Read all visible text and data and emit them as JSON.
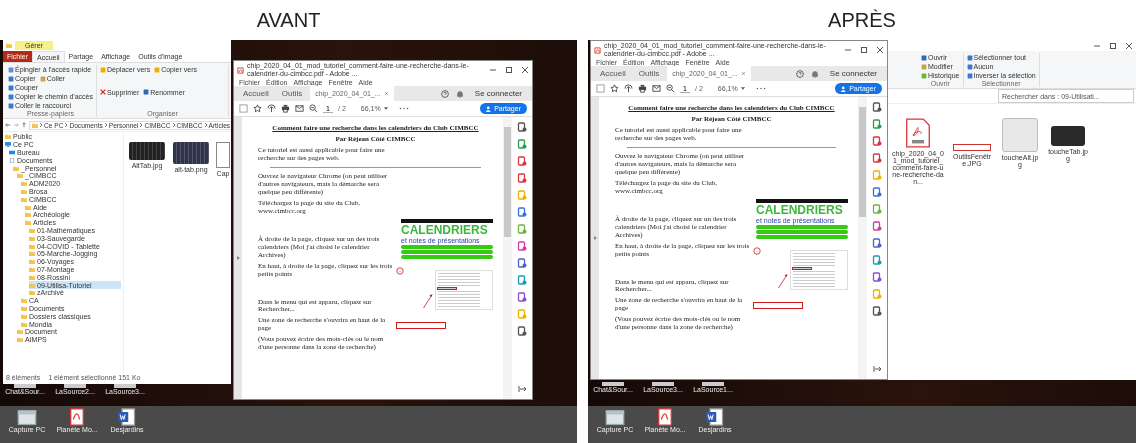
{
  "panels": [
    {
      "caption": "AVANT",
      "explorer": {
        "context_tab": "Gérer",
        "ribbon_tabs": [
          {
            "label": "Fichier",
            "kind": "file",
            "selected": false
          },
          {
            "label": "Accueil",
            "kind": "tab",
            "selected": true
          },
          {
            "label": "Partage",
            "kind": "tab",
            "selected": false
          },
          {
            "label": "Affichage",
            "kind": "tab",
            "selected": false
          },
          {
            "label": "Outils d'image",
            "kind": "tab",
            "selected": false
          }
        ],
        "ribbon_groups": [
          {
            "label": "Presse-papiers",
            "commands": [
              {
                "label": "Épingler à l'accès rapide",
                "kind": "pin"
              },
              {
                "label": "Copier",
                "kind": "copy"
              },
              {
                "label": "Coller",
                "kind": "paste"
              },
              {
                "label": "Couper",
                "kind": "cut"
              },
              {
                "label": "Copier le chemin d'accès",
                "kind": "path"
              },
              {
                "label": "Coller le raccourci",
                "kind": "shortcut"
              }
            ]
          },
          {
            "label": "Organiser",
            "commands": [
              {
                "label": "Déplacer vers",
                "kind": "move"
              },
              {
                "label": "Copier vers",
                "kind": "move"
              },
              {
                "label": "Supprimer",
                "kind": "delete"
              },
              {
                "label": "Renommer",
                "kind": "rename"
              }
            ]
          }
        ],
        "address": [
          "Ce PC",
          "Documents",
          "Personnel",
          "CIMBCC",
          "CIMBCC",
          "Articles"
        ],
        "tree": [
          {
            "label": "Public",
            "selected": false
          },
          {
            "label": "Ce PC",
            "kind": "pc",
            "selected": false,
            "children": [
              {
                "label": "Bureau",
                "kind": "desktop",
                "selected": false
              },
              {
                "label": "Documents",
                "kind": "docs",
                "selected": false,
                "children": [
                  {
                    "label": "_Personnel",
                    "selected": false,
                    "children": [
                      {
                        "label": "_CIMBCC",
                        "selected": false,
                        "children": [
                          {
                            "label": "ADM2020",
                            "selected": false
                          },
                          {
                            "label": "Brosa",
                            "selected": false
                          },
                          {
                            "label": "CIMBCC",
                            "selected": false,
                            "children": [
                              {
                                "label": "Aide",
                                "selected": false
                              },
                              {
                                "label": "Archéologie",
                                "selected": false
                              },
                              {
                                "label": "Articles",
                                "selected": false,
                                "children": [
                                  {
                                    "label": "01-Mathématiques",
                                    "selected": false
                                  },
                                  {
                                    "label": "03-Sauvegarde",
                                    "selected": false
                                  },
                                  {
                                    "label": "04-COVID - Tablette",
                                    "selected": false
                                  },
                                  {
                                    "label": "05-Marche-Jogging",
                                    "selected": false
                                  },
                                  {
                                    "label": "06-Voyages",
                                    "selected": false
                                  },
                                  {
                                    "label": "07-Montage",
                                    "selected": false
                                  },
                                  {
                                    "label": "08-Rossini",
                                    "selected": false
                                  },
                                  {
                                    "label": "09-Utilisa-Tutoriel",
                                    "selected": true
                                  },
                                  {
                                    "label": "zArchivé",
                                    "selected": false
                                  }
                                ]
                              }
                            ]
                          },
                          {
                            "label": "CA",
                            "selected": false
                          },
                          {
                            "label": "Documents",
                            "selected": false
                          },
                          {
                            "label": "Dossiers classiques",
                            "selected": false
                          },
                          {
                            "label": "Mondia",
                            "selected": false
                          }
                        ]
                      },
                      {
                        "label": "Document",
                        "selected": false
                      },
                      {
                        "label": "AIMPS",
                        "selected": false
                      }
                    ]
                  }
                ]
              }
            ]
          }
        ],
        "files": [
          {
            "name": "AltTab.jpg",
            "kind": "dark-keyboard"
          },
          {
            "name": "alt-tab.png",
            "kind": "blue-keyboard"
          },
          {
            "name": "Cap",
            "kind": "window"
          }
        ],
        "status": [
          "8 éléments",
          "1 élément sélectionné 151 Ko"
        ]
      },
      "acrobat": {
        "title": "chip_2020_04_01_mod_tutoriel_comment-faire-une-recherche-dans-le-calendrier-du-cimbcc.pdf - Adobe ...",
        "menus": [
          "Fichier",
          "Édition",
          "Affichage",
          "Fenêtre",
          "Aide"
        ],
        "tabs": [
          {
            "label": "Accueil",
            "selected": false
          },
          {
            "label": "Outils",
            "selected": false
          },
          {
            "label": "chip_2020_04_01_...",
            "selected": true
          }
        ],
        "sign_in": "Se connecter",
        "page": "1",
        "page_total": "/ 2",
        "zoom": "66,1%",
        "share": "Partager",
        "content": [
          {
            "kind": "heading",
            "text": "Comment faire une recherche dans les calendriers du Club CIMBCC"
          },
          {
            "kind": "byline",
            "text": "Par Réjean Côté CIMBCC"
          },
          {
            "kind": "para",
            "text": "Ce tutoriel est aussi applicable pour faire une recherche sur des pages web."
          },
          {
            "kind": "rule"
          },
          {
            "kind": "para",
            "text": "Ouvrez le navigateur Chrome (on peut utiliser d'autres navigateurs, mais la démarche sera quelque peu différente)"
          },
          {
            "kind": "para",
            "text": "Téléchargez la page du site du Club, www.cimbcc.org"
          },
          {
            "kind": "banner",
            "title": "CALENDRIERS",
            "subtitle": "et notes de présentations"
          },
          {
            "kind": "para",
            "text": "À droite de la page, cliquez sur un des trois calendriers (Moi j'ai choisi le calendrier Archives)"
          },
          {
            "kind": "circled",
            "text": "En haut, à droite de la page, cliquez sur les trois petits points"
          },
          {
            "kind": "menu-screenshot"
          },
          {
            "kind": "para",
            "text": "Dans le menu qui est apparu, cliquez sur Rechercher..."
          },
          {
            "kind": "boxed",
            "text": "Une zone de recherche s'ouvrira en haut de la page"
          },
          {
            "kind": "para",
            "text": "(Vous pouvez écrire des mots-clés ou le nom d'une personne dans la zone de recherche)"
          }
        ]
      },
      "desktop_icons": [
        "Chat&Sour...",
        "LaSource2...",
        "LaSource3..."
      ],
      "taskbar_icons": [
        {
          "label": "Capture PC",
          "kind": "window"
        },
        {
          "label": "Planète Mo...",
          "kind": "pdf"
        },
        {
          "label": "Desjardins",
          "kind": "word"
        }
      ]
    },
    {
      "caption": "APRÈS",
      "explorer": {
        "ribbon_groups": [
          {
            "label": "Ouvrir",
            "commands": [
              {
                "label": "Ouvrir",
                "kind": "open"
              },
              {
                "label": "Modifier",
                "kind": "edit"
              },
              {
                "label": "Historique",
                "kind": "history"
              }
            ]
          },
          {
            "label": "Sélectionner",
            "commands": [
              {
                "label": "Sélectionner tout",
                "kind": "select"
              },
              {
                "label": "Aucun",
                "kind": "select"
              },
              {
                "label": "Inverser la sélection",
                "kind": "select"
              }
            ]
          }
        ],
        "search": {
          "placeholder": "Rechercher dans : 09-Utilisati..."
        },
        "files": [
          {
            "name": "chip_2020_04_01_mod_tutoriel_comment-faire-une-recherche-dan...",
            "kind": "pdf"
          },
          {
            "name": "OutilsFenêtre.JPG",
            "kind": "strip"
          },
          {
            "name": "toucheAlt.jpg",
            "kind": "light-key"
          },
          {
            "name": "toucheTab.jpg",
            "kind": "dark-key"
          }
        ]
      },
      "acrobat": {
        "title": "chip_2020_04_01_mod_tutoriel_comment-faire-une-recherche-dans-le-calendrier-du-cimbcc.pdf - Adobe ...",
        "menus": [
          "Fichier",
          "Édition",
          "Affichage",
          "Fenêtre",
          "Aide"
        ],
        "tabs": [
          {
            "label": "Accueil",
            "selected": false
          },
          {
            "label": "Outils",
            "selected": false
          },
          {
            "label": "chip_2020_04_01_...",
            "selected": true
          }
        ],
        "sign_in": "Se connecter",
        "page": "1",
        "page_total": "/ 2",
        "zoom": "66,1%",
        "share": "Partager",
        "content": [
          {
            "kind": "heading",
            "text": "Comment faire une recherche dans les calendriers du Club CIMBCC"
          },
          {
            "kind": "byline",
            "text": "Par Réjean Côté CIMBCC"
          },
          {
            "kind": "para",
            "text": "Ce tutoriel est aussi applicable pour faire une recherche sur des pages web."
          },
          {
            "kind": "rule"
          },
          {
            "kind": "para",
            "text": "Ouvrez le navigateur Chrome (on peut utiliser d'autres navigateurs, mais la démarche sera quelque peu différente)"
          },
          {
            "kind": "para",
            "text": "Téléchargez la page du site du Club, www.cimbcc.org"
          },
          {
            "kind": "banner",
            "title": "CALENDRIERS",
            "subtitle": "et notes de présentations"
          },
          {
            "kind": "para",
            "text": "À droite de la page, cliquez sur un des trois calendriers (Moi j'ai choisi le calendrier Archives)"
          },
          {
            "kind": "circled",
            "text": "En haut, à droite de la page, cliquez sur les trois petits points"
          },
          {
            "kind": "menu-screenshot"
          },
          {
            "kind": "para",
            "text": "Dans le menu qui est apparu, cliquez sur Rechercher..."
          },
          {
            "kind": "boxed",
            "text": "Une zone de recherche s'ouvrira en haut de la page"
          },
          {
            "kind": "para",
            "text": "(Vous pouvez écrire des mots-clés ou le nom d'une personne dans la zone de recherche)"
          }
        ]
      },
      "desktop_icons": [
        "Chat&Sour...",
        "LaSource3...",
        "LaSource1..."
      ],
      "taskbar_icons": [
        {
          "label": "Capture PC",
          "kind": "window"
        },
        {
          "label": "Planète Mo...",
          "kind": "pdf"
        },
        {
          "label": "Desjardins",
          "kind": "word"
        }
      ]
    }
  ]
}
